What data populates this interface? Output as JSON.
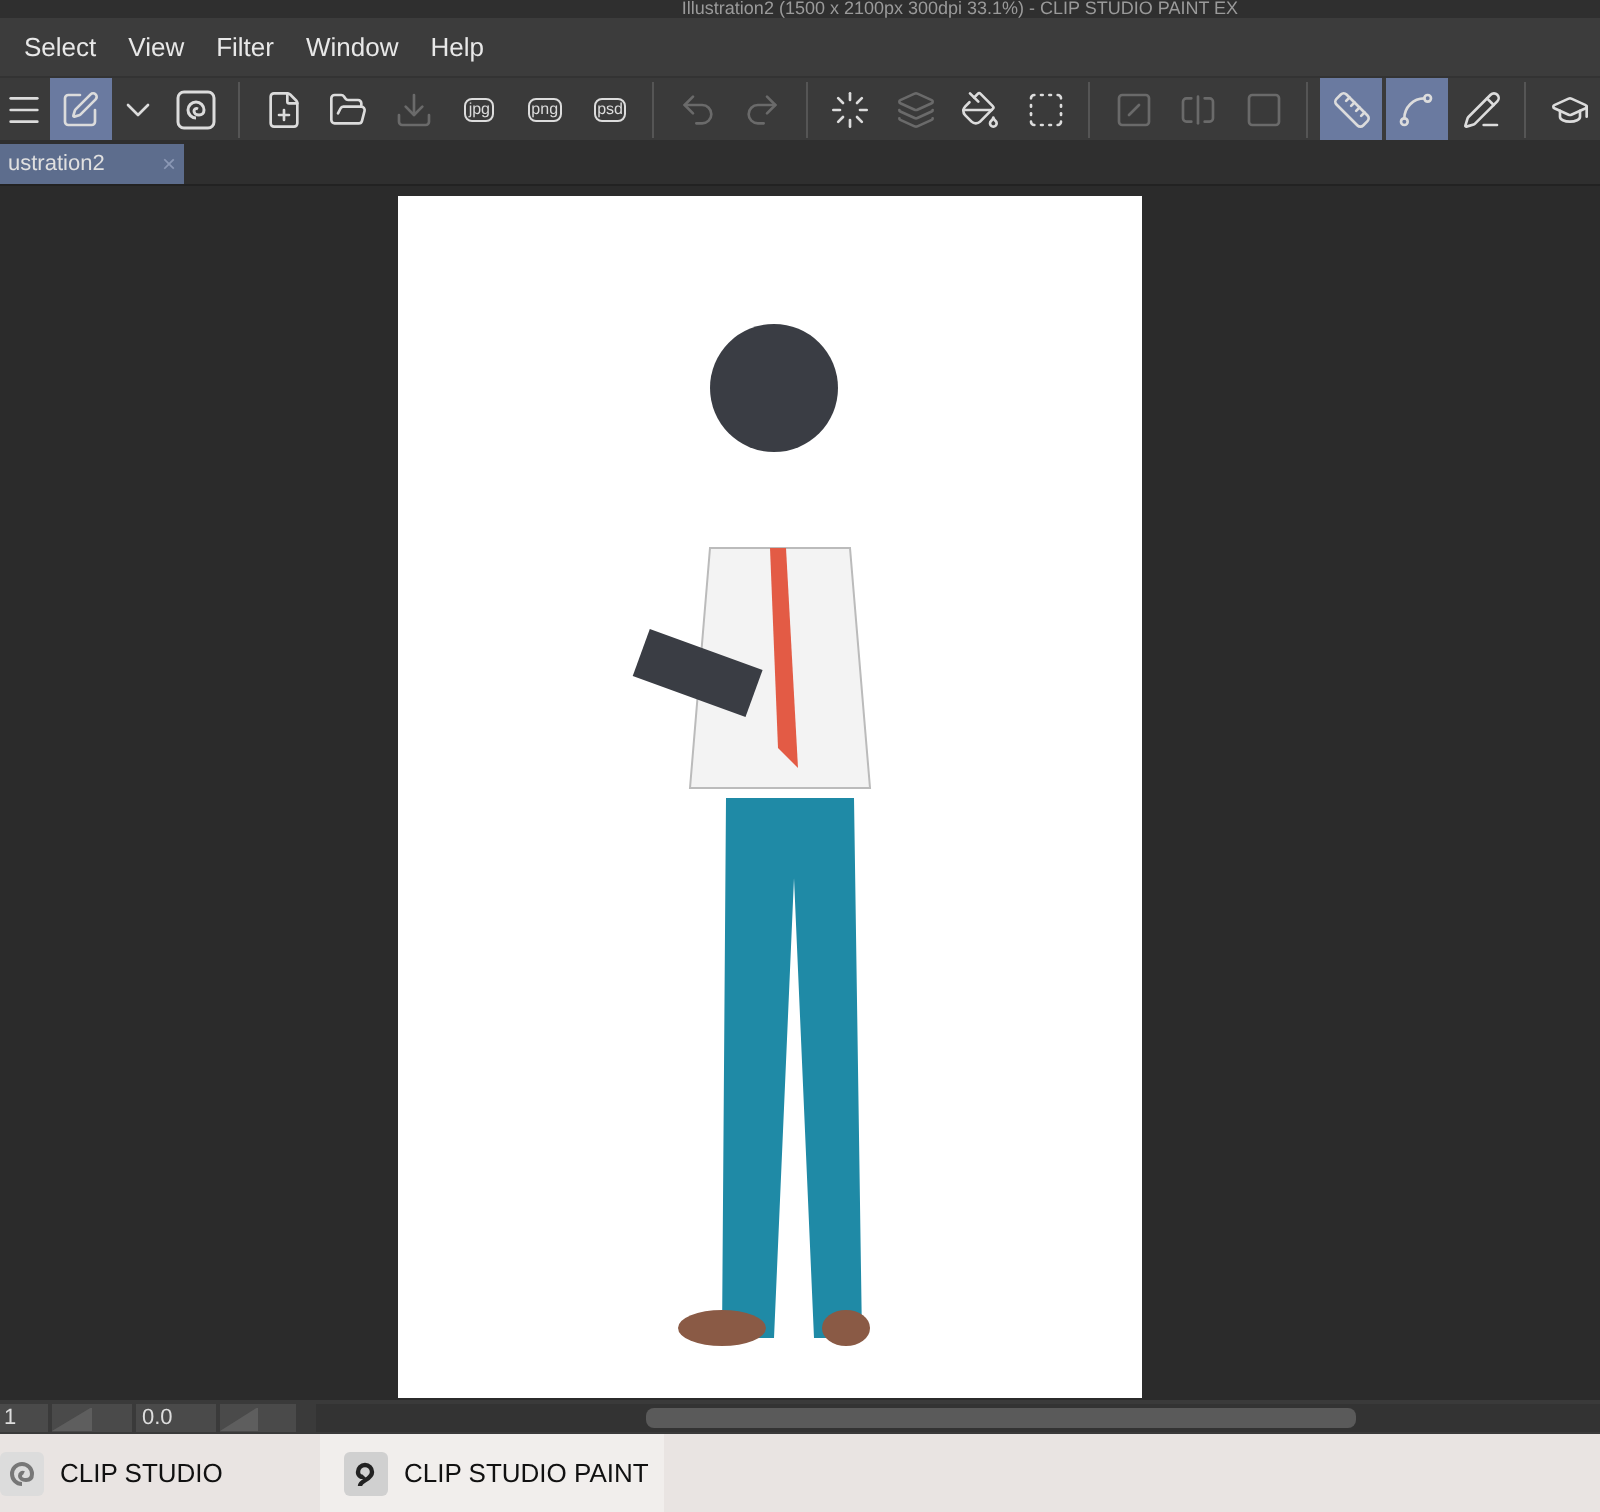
{
  "window": {
    "title": "Illustration2 (1500 x 2100px 300dpi 33.1%)  - CLIP STUDIO PAINT EX"
  },
  "menu": [
    "Select",
    "View",
    "Filter",
    "Window",
    "Help"
  ],
  "toolbar": [
    {
      "kind": "menu",
      "selected": false,
      "disabled": false
    },
    {
      "kind": "pen",
      "selected": true,
      "disabled": false
    },
    {
      "kind": "chevron",
      "selected": false,
      "disabled": false
    },
    {
      "kind": "swirl",
      "selected": false,
      "disabled": false
    },
    {
      "kind": "sep"
    },
    {
      "kind": "new",
      "selected": false,
      "disabled": false
    },
    {
      "kind": "open",
      "selected": false,
      "disabled": false
    },
    {
      "kind": "import",
      "selected": false,
      "disabled": true
    },
    {
      "kind": "file",
      "label": "jpg",
      "selected": false,
      "disabled": false
    },
    {
      "kind": "file",
      "label": "png",
      "selected": false,
      "disabled": false
    },
    {
      "kind": "file",
      "label": "psd",
      "selected": false,
      "disabled": false
    },
    {
      "kind": "sep"
    },
    {
      "kind": "undo",
      "selected": false,
      "disabled": true
    },
    {
      "kind": "redo",
      "selected": false,
      "disabled": true
    },
    {
      "kind": "sep"
    },
    {
      "kind": "spinner",
      "selected": false,
      "disabled": false
    },
    {
      "kind": "layers",
      "selected": false,
      "disabled": true
    },
    {
      "kind": "bucket",
      "selected": false,
      "disabled": false
    },
    {
      "kind": "transform",
      "selected": false,
      "disabled": false
    },
    {
      "kind": "sep"
    },
    {
      "kind": "diagonal",
      "selected": false,
      "disabled": true
    },
    {
      "kind": "half",
      "selected": false,
      "disabled": true
    },
    {
      "kind": "frame",
      "selected": false,
      "disabled": true
    },
    {
      "kind": "sep"
    },
    {
      "kind": "ruler",
      "selected": true,
      "disabled": false
    },
    {
      "kind": "curve",
      "selected": true,
      "disabled": false
    },
    {
      "kind": "ruler2",
      "selected": false,
      "disabled": false
    },
    {
      "kind": "sep"
    },
    {
      "kind": "cap",
      "selected": false,
      "disabled": false
    }
  ],
  "tabs": [
    {
      "label": "ustration2",
      "selected": true,
      "close": "×"
    }
  ],
  "status_bar": {
    "field_1": "1",
    "zoom_slider": {
      "level": 0.5
    },
    "field_2": "0.0",
    "rotation_slider": {
      "level": 0.5
    }
  },
  "taskbar": [
    {
      "kind": "studio",
      "label": "CLIP STUDIO"
    },
    {
      "kind": "paint",
      "label": "CLIP STUDIO PAINT"
    }
  ]
}
